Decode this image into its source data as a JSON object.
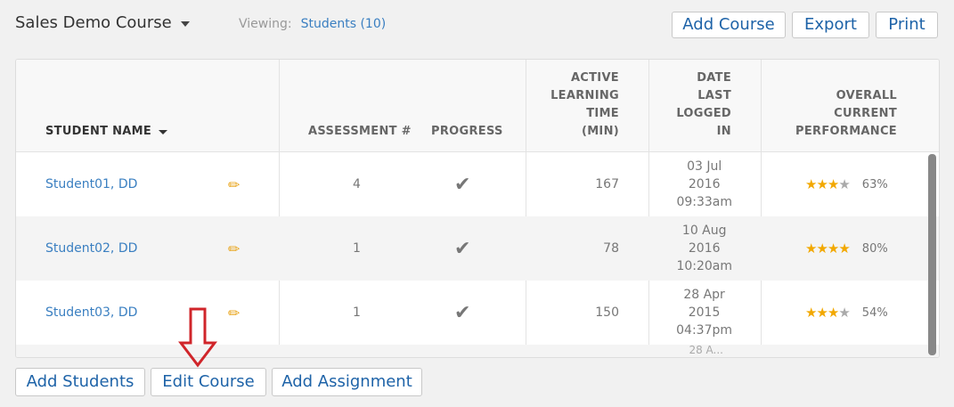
{
  "header": {
    "course_title": "Sales Demo Course",
    "viewing_label": "Viewing:",
    "viewing_link": "Students (10)",
    "buttons": {
      "add_course": "Add Course",
      "export": "Export",
      "print": "Print"
    }
  },
  "table": {
    "columns": {
      "student_name": "STUDENT NAME",
      "assessment": "ASSESSMENT #",
      "progress": "PROGRESS",
      "active_time": [
        "ACTIVE",
        "LEARNING",
        "TIME",
        "(MIN)"
      ],
      "date_last": [
        "DATE",
        "LAST",
        "LOGGED",
        "IN"
      ],
      "performance": [
        "OVERALL",
        "CURRENT",
        "PERFORMANCE"
      ]
    },
    "rows": [
      {
        "name": "Student01, DD",
        "assessment": "4",
        "active_time": "167",
        "date": [
          "03 Jul",
          "2016",
          "09:33am"
        ],
        "stars": 3,
        "percent": "63%"
      },
      {
        "name": "Student02, DD",
        "assessment": "1",
        "active_time": "78",
        "date": [
          "10 Aug",
          "2016",
          "10:20am"
        ],
        "stars": 4,
        "percent": "80%"
      },
      {
        "name": "Student03, DD",
        "assessment": "1",
        "active_time": "150",
        "date": [
          "28 Apr",
          "2015",
          "04:37pm"
        ],
        "stars": 3,
        "percent": "54%"
      }
    ],
    "partial_row_date": "28 A..."
  },
  "footer": {
    "add_students": "Add Students",
    "edit_course": "Edit Course",
    "add_assignment": "Add Assignment"
  },
  "icons": {
    "pencil": "pencil-icon",
    "check": "checkmark-icon",
    "star": "star-icon",
    "arrow": "arrow-down-icon"
  },
  "colors": {
    "link": "#3a7fc1",
    "button_text": "#1e63a8",
    "star": "#f2a800",
    "arrow": "#d0252a"
  }
}
